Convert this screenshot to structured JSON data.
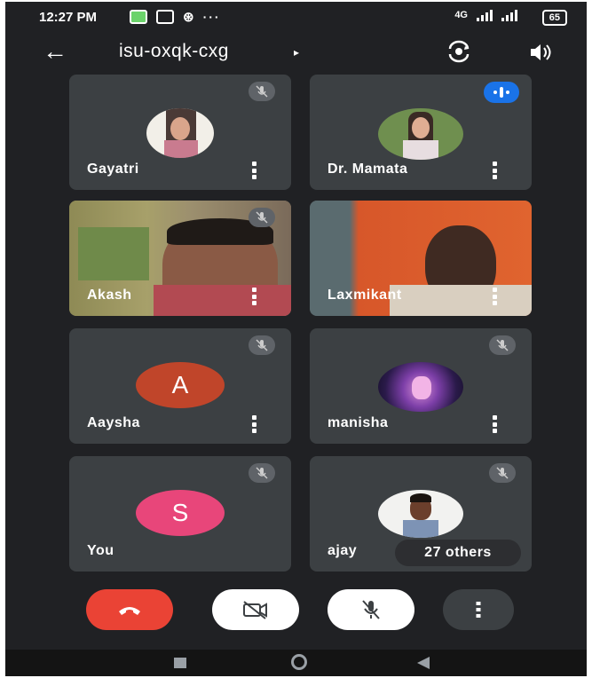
{
  "status_bar": {
    "time": "12:27 PM",
    "dots": "···",
    "network": "4G",
    "battery": "65"
  },
  "top_bar": {
    "meeting_code": "isu-oxqk-cxg",
    "arrow": "▸"
  },
  "participants": [
    {
      "name": "Gayatri",
      "muted": true,
      "avatar": "photo"
    },
    {
      "name": "Dr. Mamata",
      "speaking": true,
      "avatar": "photo"
    },
    {
      "name": "Akash",
      "muted": true,
      "avatar": "video"
    },
    {
      "name": "Laxmikant",
      "muted": false,
      "avatar": "video"
    },
    {
      "name": "Aaysha",
      "muted": true,
      "avatar_letter": "A",
      "avatar_color": "#c0452a"
    },
    {
      "name": "manisha",
      "muted": true,
      "avatar": "photo"
    },
    {
      "name": "You",
      "muted": true,
      "avatar_letter": "S",
      "avatar_color": "#e8467a"
    },
    {
      "name": "ajay",
      "muted": true,
      "avatar": "photo",
      "others_label": "27 others"
    }
  ],
  "controls": {
    "end_call_color": "#ea4335",
    "icons": [
      "end-call-icon",
      "camera-off-icon",
      "mic-off-icon",
      "more-vert-icon"
    ]
  },
  "colors": {
    "background": "#202124",
    "tile": "#3c4043",
    "accent": "#1a73e8"
  }
}
